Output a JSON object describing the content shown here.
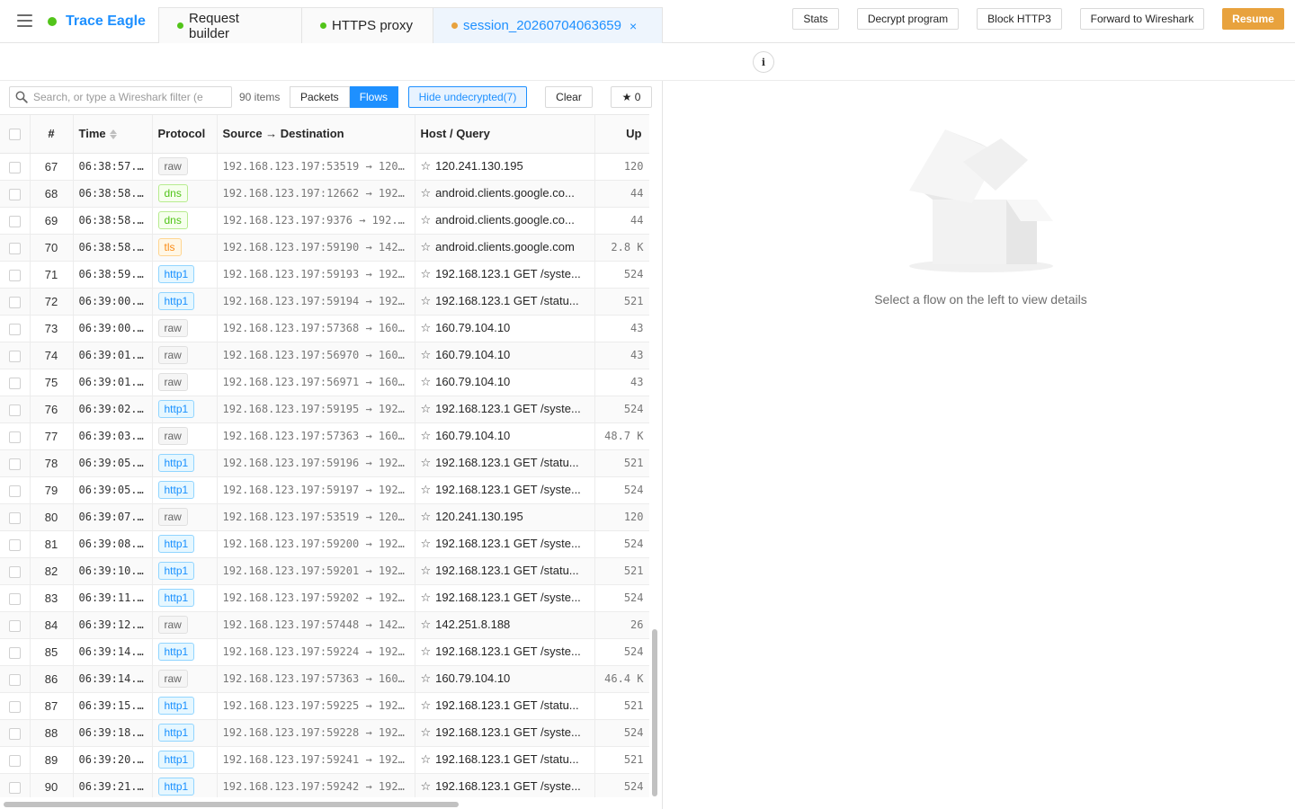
{
  "app": {
    "name": "Trace Eagle",
    "status_color": "#52c41a"
  },
  "tabs": [
    {
      "label": "Request builder",
      "dot_color": "#52c41a"
    },
    {
      "label": "HTTPS proxy",
      "dot_color": "#52c41a"
    },
    {
      "label": "session_20260704063659",
      "dot_color": "#e8a23d",
      "close": "×"
    }
  ],
  "toolbar": {
    "info": "i",
    "stats": "Stats",
    "decrypt": "Decrypt program",
    "block_http3": "Block HTTP3",
    "forward": "Forward to Wireshark",
    "resume": "Resume"
  },
  "filter": {
    "placeholder": "Search, or type a Wireshark filter (e",
    "count": "90 items",
    "packets": "Packets",
    "flows": "Flows",
    "hide_undecrypted": "Hide undecrypted(7)",
    "clear": "Clear",
    "starred": "★ 0"
  },
  "table": {
    "columns": [
      "#",
      "Time",
      "Protocol",
      "Source → Destination",
      "Host / Query",
      "Up"
    ],
    "rows": [
      [
        "67",
        "06:38:57....",
        "raw",
        "192.168.123.197:53519 → 120...",
        "120.241.130.195",
        "120"
      ],
      [
        "68",
        "06:38:58....",
        "dns",
        "192.168.123.197:12662 → 192...",
        "android.clients.google.co...",
        "44"
      ],
      [
        "69",
        "06:38:58....",
        "dns",
        "192.168.123.197:9376 → 192....",
        "android.clients.google.co...",
        "44"
      ],
      [
        "70",
        "06:38:58....",
        "tls",
        "192.168.123.197:59190 → 142...",
        "android.clients.google.com",
        "2.8 K"
      ],
      [
        "71",
        "06:38:59....",
        "http1",
        "192.168.123.197:59193 → 192...",
        "192.168.123.1 GET /syste...",
        "524"
      ],
      [
        "72",
        "06:39:00....",
        "http1",
        "192.168.123.197:59194 → 192...",
        "192.168.123.1 GET /statu...",
        "521"
      ],
      [
        "73",
        "06:39:00....",
        "raw",
        "192.168.123.197:57368 → 160...",
        "160.79.104.10",
        "43"
      ],
      [
        "74",
        "06:39:01....",
        "raw",
        "192.168.123.197:56970 → 160...",
        "160.79.104.10",
        "43"
      ],
      [
        "75",
        "06:39:01....",
        "raw",
        "192.168.123.197:56971 → 160...",
        "160.79.104.10",
        "43"
      ],
      [
        "76",
        "06:39:02....",
        "http1",
        "192.168.123.197:59195 → 192...",
        "192.168.123.1 GET /syste...",
        "524"
      ],
      [
        "77",
        "06:39:03....",
        "raw",
        "192.168.123.197:57363 → 160...",
        "160.79.104.10",
        "48.7 K"
      ],
      [
        "78",
        "06:39:05....",
        "http1",
        "192.168.123.197:59196 → 192...",
        "192.168.123.1 GET /statu...",
        "521"
      ],
      [
        "79",
        "06:39:05....",
        "http1",
        "192.168.123.197:59197 → 192...",
        "192.168.123.1 GET /syste...",
        "524"
      ],
      [
        "80",
        "06:39:07....",
        "raw",
        "192.168.123.197:53519 → 120...",
        "120.241.130.195",
        "120"
      ],
      [
        "81",
        "06:39:08....",
        "http1",
        "192.168.123.197:59200 → 192...",
        "192.168.123.1 GET /syste...",
        "524"
      ],
      [
        "82",
        "06:39:10....",
        "http1",
        "192.168.123.197:59201 → 192...",
        "192.168.123.1 GET /statu...",
        "521"
      ],
      [
        "83",
        "06:39:11....",
        "http1",
        "192.168.123.197:59202 → 192...",
        "192.168.123.1 GET /syste...",
        "524"
      ],
      [
        "84",
        "06:39:12....",
        "raw",
        "192.168.123.197:57448 → 142...",
        "142.251.8.188",
        "26"
      ],
      [
        "85",
        "06:39:14....",
        "http1",
        "192.168.123.197:59224 → 192...",
        "192.168.123.1 GET /syste...",
        "524"
      ],
      [
        "86",
        "06:39:14....",
        "raw",
        "192.168.123.197:57363 → 160...",
        "160.79.104.10",
        "46.4 K"
      ],
      [
        "87",
        "06:39:15....",
        "http1",
        "192.168.123.197:59225 → 192...",
        "192.168.123.1 GET /statu...",
        "521"
      ],
      [
        "88",
        "06:39:18....",
        "http1",
        "192.168.123.197:59228 → 192...",
        "192.168.123.1 GET /syste...",
        "524"
      ],
      [
        "89",
        "06:39:20....",
        "http1",
        "192.168.123.197:59241 → 192...",
        "192.168.123.1 GET /statu...",
        "521"
      ],
      [
        "90",
        "06:39:21....",
        "http1",
        "192.168.123.197:59242 → 192...",
        "192.168.123.1 GET /syste...",
        "524"
      ]
    ]
  },
  "detail": {
    "empty_text": "Select a flow on the left to view details"
  }
}
